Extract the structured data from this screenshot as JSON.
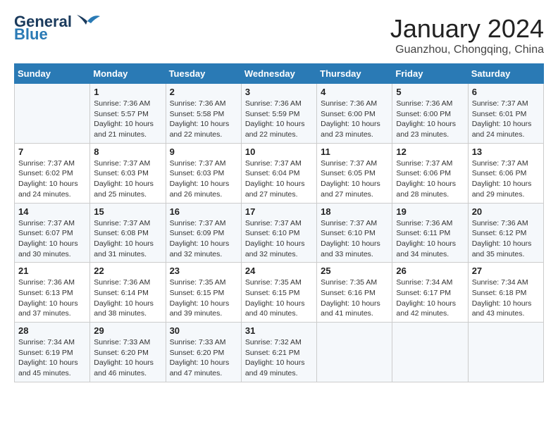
{
  "header": {
    "logo_line1": "General",
    "logo_line2": "Blue",
    "month": "January 2024",
    "location": "Guanzhou, Chongqing, China"
  },
  "days_of_week": [
    "Sunday",
    "Monday",
    "Tuesday",
    "Wednesday",
    "Thursday",
    "Friday",
    "Saturday"
  ],
  "weeks": [
    [
      {
        "day": "",
        "sunrise": "",
        "sunset": "",
        "daylight": ""
      },
      {
        "day": "1",
        "sunrise": "Sunrise: 7:36 AM",
        "sunset": "Sunset: 5:57 PM",
        "daylight": "Daylight: 10 hours and 21 minutes."
      },
      {
        "day": "2",
        "sunrise": "Sunrise: 7:36 AM",
        "sunset": "Sunset: 5:58 PM",
        "daylight": "Daylight: 10 hours and 22 minutes."
      },
      {
        "day": "3",
        "sunrise": "Sunrise: 7:36 AM",
        "sunset": "Sunset: 5:59 PM",
        "daylight": "Daylight: 10 hours and 22 minutes."
      },
      {
        "day": "4",
        "sunrise": "Sunrise: 7:36 AM",
        "sunset": "Sunset: 6:00 PM",
        "daylight": "Daylight: 10 hours and 23 minutes."
      },
      {
        "day": "5",
        "sunrise": "Sunrise: 7:36 AM",
        "sunset": "Sunset: 6:00 PM",
        "daylight": "Daylight: 10 hours and 23 minutes."
      },
      {
        "day": "6",
        "sunrise": "Sunrise: 7:37 AM",
        "sunset": "Sunset: 6:01 PM",
        "daylight": "Daylight: 10 hours and 24 minutes."
      }
    ],
    [
      {
        "day": "7",
        "sunrise": "Sunrise: 7:37 AM",
        "sunset": "Sunset: 6:02 PM",
        "daylight": "Daylight: 10 hours and 24 minutes."
      },
      {
        "day": "8",
        "sunrise": "Sunrise: 7:37 AM",
        "sunset": "Sunset: 6:03 PM",
        "daylight": "Daylight: 10 hours and 25 minutes."
      },
      {
        "day": "9",
        "sunrise": "Sunrise: 7:37 AM",
        "sunset": "Sunset: 6:03 PM",
        "daylight": "Daylight: 10 hours and 26 minutes."
      },
      {
        "day": "10",
        "sunrise": "Sunrise: 7:37 AM",
        "sunset": "Sunset: 6:04 PM",
        "daylight": "Daylight: 10 hours and 27 minutes."
      },
      {
        "day": "11",
        "sunrise": "Sunrise: 7:37 AM",
        "sunset": "Sunset: 6:05 PM",
        "daylight": "Daylight: 10 hours and 27 minutes."
      },
      {
        "day": "12",
        "sunrise": "Sunrise: 7:37 AM",
        "sunset": "Sunset: 6:06 PM",
        "daylight": "Daylight: 10 hours and 28 minutes."
      },
      {
        "day": "13",
        "sunrise": "Sunrise: 7:37 AM",
        "sunset": "Sunset: 6:06 PM",
        "daylight": "Daylight: 10 hours and 29 minutes."
      }
    ],
    [
      {
        "day": "14",
        "sunrise": "Sunrise: 7:37 AM",
        "sunset": "Sunset: 6:07 PM",
        "daylight": "Daylight: 10 hours and 30 minutes."
      },
      {
        "day": "15",
        "sunrise": "Sunrise: 7:37 AM",
        "sunset": "Sunset: 6:08 PM",
        "daylight": "Daylight: 10 hours and 31 minutes."
      },
      {
        "day": "16",
        "sunrise": "Sunrise: 7:37 AM",
        "sunset": "Sunset: 6:09 PM",
        "daylight": "Daylight: 10 hours and 32 minutes."
      },
      {
        "day": "17",
        "sunrise": "Sunrise: 7:37 AM",
        "sunset": "Sunset: 6:10 PM",
        "daylight": "Daylight: 10 hours and 32 minutes."
      },
      {
        "day": "18",
        "sunrise": "Sunrise: 7:37 AM",
        "sunset": "Sunset: 6:10 PM",
        "daylight": "Daylight: 10 hours and 33 minutes."
      },
      {
        "day": "19",
        "sunrise": "Sunrise: 7:36 AM",
        "sunset": "Sunset: 6:11 PM",
        "daylight": "Daylight: 10 hours and 34 minutes."
      },
      {
        "day": "20",
        "sunrise": "Sunrise: 7:36 AM",
        "sunset": "Sunset: 6:12 PM",
        "daylight": "Daylight: 10 hours and 35 minutes."
      }
    ],
    [
      {
        "day": "21",
        "sunrise": "Sunrise: 7:36 AM",
        "sunset": "Sunset: 6:13 PM",
        "daylight": "Daylight: 10 hours and 37 minutes."
      },
      {
        "day": "22",
        "sunrise": "Sunrise: 7:36 AM",
        "sunset": "Sunset: 6:14 PM",
        "daylight": "Daylight: 10 hours and 38 minutes."
      },
      {
        "day": "23",
        "sunrise": "Sunrise: 7:35 AM",
        "sunset": "Sunset: 6:15 PM",
        "daylight": "Daylight: 10 hours and 39 minutes."
      },
      {
        "day": "24",
        "sunrise": "Sunrise: 7:35 AM",
        "sunset": "Sunset: 6:15 PM",
        "daylight": "Daylight: 10 hours and 40 minutes."
      },
      {
        "day": "25",
        "sunrise": "Sunrise: 7:35 AM",
        "sunset": "Sunset: 6:16 PM",
        "daylight": "Daylight: 10 hours and 41 minutes."
      },
      {
        "day": "26",
        "sunrise": "Sunrise: 7:34 AM",
        "sunset": "Sunset: 6:17 PM",
        "daylight": "Daylight: 10 hours and 42 minutes."
      },
      {
        "day": "27",
        "sunrise": "Sunrise: 7:34 AM",
        "sunset": "Sunset: 6:18 PM",
        "daylight": "Daylight: 10 hours and 43 minutes."
      }
    ],
    [
      {
        "day": "28",
        "sunrise": "Sunrise: 7:34 AM",
        "sunset": "Sunset: 6:19 PM",
        "daylight": "Daylight: 10 hours and 45 minutes."
      },
      {
        "day": "29",
        "sunrise": "Sunrise: 7:33 AM",
        "sunset": "Sunset: 6:20 PM",
        "daylight": "Daylight: 10 hours and 46 minutes."
      },
      {
        "day": "30",
        "sunrise": "Sunrise: 7:33 AM",
        "sunset": "Sunset: 6:20 PM",
        "daylight": "Daylight: 10 hours and 47 minutes."
      },
      {
        "day": "31",
        "sunrise": "Sunrise: 7:32 AM",
        "sunset": "Sunset: 6:21 PM",
        "daylight": "Daylight: 10 hours and 49 minutes."
      },
      {
        "day": "",
        "sunrise": "",
        "sunset": "",
        "daylight": ""
      },
      {
        "day": "",
        "sunrise": "",
        "sunset": "",
        "daylight": ""
      },
      {
        "day": "",
        "sunrise": "",
        "sunset": "",
        "daylight": ""
      }
    ]
  ]
}
